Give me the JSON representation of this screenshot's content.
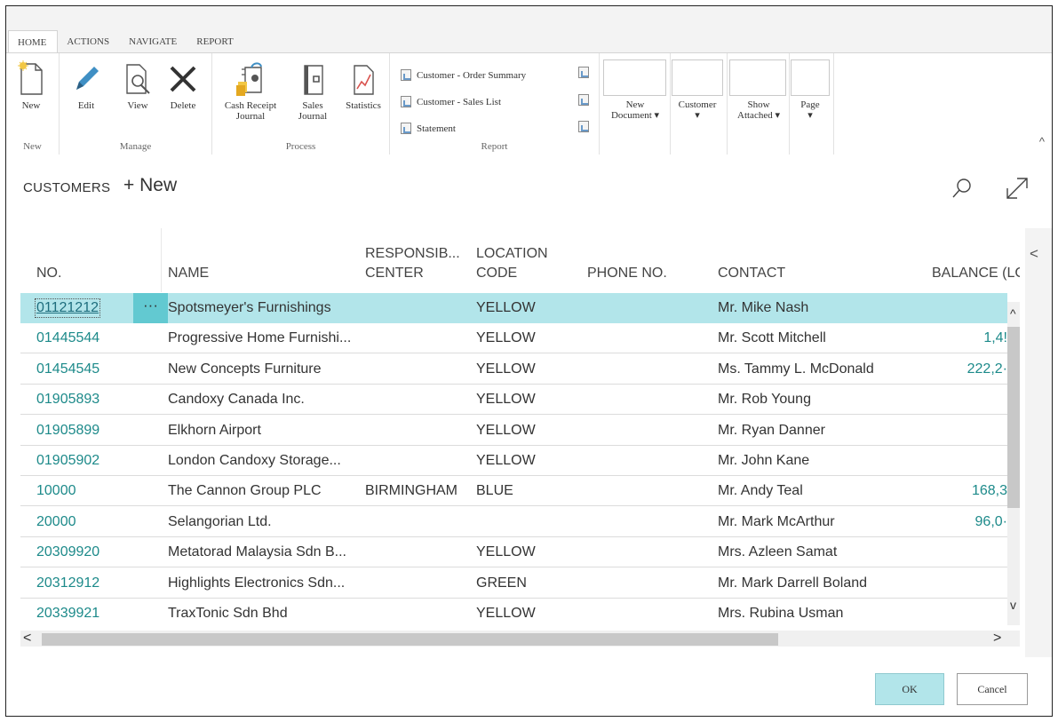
{
  "ribbon": {
    "tabs": [
      "HOME",
      "ACTIONS",
      "NAVIGATE",
      "REPORT"
    ],
    "new_group": {
      "label": "New",
      "new_button": "New"
    },
    "manage_group": {
      "label": "Manage",
      "edit": "Edit",
      "view": "View",
      "delete": "Delete"
    },
    "process_group": {
      "label": "Process",
      "cash_receipt_1": "Cash Receipt",
      "cash_receipt_2": "Journal",
      "sales_1": "Sales",
      "sales_2": "Journal",
      "statistics": "Statistics"
    },
    "report_group": {
      "label": "Report",
      "items": [
        "Customer - Order Summary",
        "Customer - Sales List",
        "Statement"
      ]
    },
    "dropdowns": {
      "new_document_1": "New",
      "new_document_2": "Document",
      "customer": "Customer",
      "show_attached_1": "Show",
      "show_attached_2": "Attached",
      "page": "Page"
    }
  },
  "header": {
    "title": "CUSTOMERS",
    "new_action": "+ New"
  },
  "table": {
    "columns": {
      "no": "NO.",
      "name": "NAME",
      "resp_1": "RESPONSIB...",
      "resp_2": "CENTER",
      "loc_1": "LOCATION",
      "loc_2": "CODE",
      "phone": "PHONE NO.",
      "contact": "CONTACT",
      "balance": "BALANCE (LC"
    },
    "row_menu": "···",
    "rows": [
      {
        "no": "01121212",
        "name": "Spotsmeyer's Furnishings",
        "resp": "",
        "loc": "YELLOW",
        "phone": "",
        "contact": "Mr. Mike Nash",
        "bal": ""
      },
      {
        "no": "01445544",
        "name": "Progressive Home Furnishi...",
        "resp": "",
        "loc": "YELLOW",
        "phone": "",
        "contact": "Mr. Scott Mitchell",
        "bal": "1,4!"
      },
      {
        "no": "01454545",
        "name": "New Concepts Furniture",
        "resp": "",
        "loc": "YELLOW",
        "phone": "",
        "contact": "Ms. Tammy L. McDonald",
        "bal": "222,2·"
      },
      {
        "no": "01905893",
        "name": "Candoxy Canada Inc.",
        "resp": "",
        "loc": "YELLOW",
        "phone": "",
        "contact": "Mr. Rob Young",
        "bal": ""
      },
      {
        "no": "01905899",
        "name": "Elkhorn Airport",
        "resp": "",
        "loc": "YELLOW",
        "phone": "",
        "contact": "Mr. Ryan Danner",
        "bal": ""
      },
      {
        "no": "01905902",
        "name": "London Candoxy Storage...",
        "resp": "",
        "loc": "YELLOW",
        "phone": "",
        "contact": "Mr. John Kane",
        "bal": ""
      },
      {
        "no": "10000",
        "name": "The Cannon Group PLC",
        "resp": "BIRMINGHAM",
        "loc": "BLUE",
        "phone": "",
        "contact": "Mr. Andy Teal",
        "bal": "168,3"
      },
      {
        "no": "20000",
        "name": "Selangorian Ltd.",
        "resp": "",
        "loc": "",
        "phone": "",
        "contact": "Mr. Mark McArthur",
        "bal": "96,0·"
      },
      {
        "no": "20309920",
        "name": "Metatorad Malaysia Sdn B...",
        "resp": "",
        "loc": "YELLOW",
        "phone": "",
        "contact": "Mrs. Azleen Samat",
        "bal": ""
      },
      {
        "no": "20312912",
        "name": "Highlights Electronics Sdn...",
        "resp": "",
        "loc": "GREEN",
        "phone": "",
        "contact": "Mr. Mark Darrell Boland",
        "bal": ""
      },
      {
        "no": "20339921",
        "name": "TraxTonic Sdn Bhd",
        "resp": "",
        "loc": "YELLOW",
        "phone": "",
        "contact": "Mrs. Rubina Usman",
        "bal": ""
      }
    ]
  },
  "footer": {
    "ok": "OK",
    "cancel": "Cancel"
  },
  "colors": {
    "accent": "#b2e5ea",
    "link": "#1d8a8a",
    "row_menu": "#62c9d1"
  },
  "icons": [
    "new-document-icon",
    "edit-icon",
    "view-icon",
    "delete-icon",
    "cash-receipt-journal-icon",
    "sales-journal-icon",
    "statistics-icon",
    "report-icon",
    "search-icon",
    "expand-icon"
  ]
}
